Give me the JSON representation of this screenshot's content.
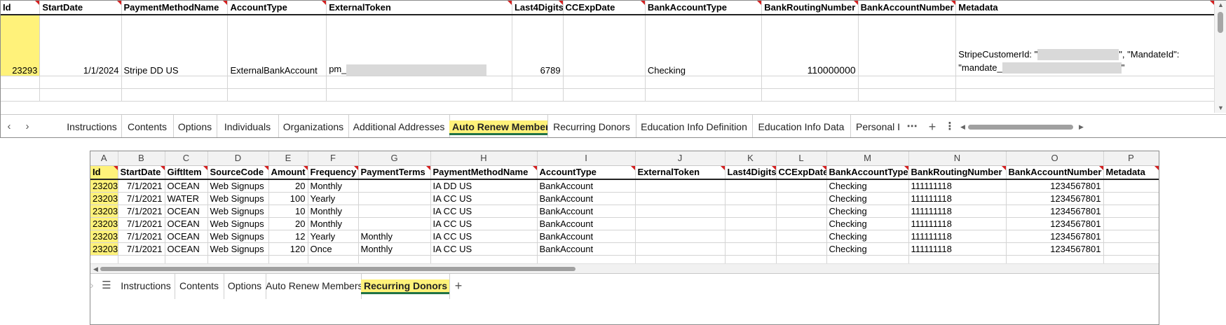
{
  "top_sheet": {
    "headers": [
      "Id",
      "StartDate",
      "PaymentMethodName",
      "AccountType",
      "ExternalToken",
      "Last4Digits",
      "CCExpDate",
      "BankAccountType",
      "BankRoutingNumber",
      "BankAccountNumber",
      "Metadata"
    ],
    "row": {
      "id": "23293",
      "start_date": "1/1/2024",
      "payment_method_name": "Stripe DD US",
      "account_type": "ExternalBankAccount",
      "external_token_prefix": "pm_",
      "last4": "6789",
      "cc_exp_date": "",
      "bank_account_type": "Checking",
      "routing": "110000000",
      "account_number": "",
      "metadata_line1_a": "StripeCustomerId: \"",
      "metadata_line1_b": "\", \"MandateId\":",
      "metadata_line2_a": "\"mandate_",
      "metadata_line2_b": "\""
    },
    "tabs": [
      "Instructions",
      "Contents",
      "Options",
      "Individuals",
      "Organizations",
      "Additional Addresses",
      "Auto Renew Members",
      "Recurring Donors",
      "Education Info Definition",
      "Education Info Data",
      "Personal I"
    ],
    "active_tab": "Auto Renew Members"
  },
  "bottom_sheet": {
    "column_letters": [
      "A",
      "B",
      "C",
      "D",
      "E",
      "F",
      "G",
      "H",
      "I",
      "J",
      "K",
      "L",
      "M",
      "N",
      "O",
      "P"
    ],
    "headers": [
      "Id",
      "StartDate",
      "GiftItem",
      "SourceCode",
      "Amount",
      "Frequency",
      "PaymentTerms",
      "PaymentMethodName",
      "AccountType",
      "ExternalToken",
      "Last4Digits",
      "CCExpDate",
      "BankAccountType",
      "BankRoutingNumber",
      "BankAccountNumber",
      "Metadata"
    ],
    "rows": [
      [
        "23203",
        "7/1/2021",
        "OCEAN",
        "Web Signups",
        "20",
        "Monthly",
        "",
        "IA DD US",
        "BankAccount",
        "",
        "",
        "",
        "Checking",
        "111111118",
        "1234567801",
        ""
      ],
      [
        "23203",
        "7/1/2021",
        "WATER",
        "Web Signups",
        "100",
        "Yearly",
        "",
        "IA CC US",
        "BankAccount",
        "",
        "",
        "",
        "Checking",
        "111111118",
        "1234567801",
        ""
      ],
      [
        "23203",
        "7/1/2021",
        "OCEAN",
        "Web Signups",
        "10",
        "Monthly",
        "",
        "IA CC US",
        "BankAccount",
        "",
        "",
        "",
        "Checking",
        "111111118",
        "1234567801",
        ""
      ],
      [
        "23203",
        "7/1/2021",
        "OCEAN",
        "Web Signups",
        "20",
        "Monthly",
        "",
        "IA CC US",
        "BankAccount",
        "",
        "",
        "",
        "Checking",
        "111111118",
        "1234567801",
        ""
      ],
      [
        "23203",
        "7/1/2021",
        "OCEAN",
        "Web Signups",
        "12",
        "Yearly",
        "Monthly",
        "IA CC US",
        "BankAccount",
        "",
        "",
        "",
        "Checking",
        "111111118",
        "1234567801",
        ""
      ],
      [
        "23203",
        "7/1/2021",
        "OCEAN",
        "Web Signups",
        "120",
        "Once",
        "Monthly",
        "IA CC US",
        "BankAccount",
        "",
        "",
        "",
        "Checking",
        "111111118",
        "1234567801",
        ""
      ]
    ],
    "tabs": [
      "Instructions",
      "Contents",
      "Options",
      "Auto Renew Members",
      "Recurring Donors"
    ],
    "active_tab": "Recurring Donors"
  },
  "icons": {
    "prev_sheet": "chevron-left-icon",
    "next_sheet": "chevron-right-icon",
    "more_sheets": "ellipsis-icon",
    "add_sheet": "plus-icon",
    "options": "vertical-ellipsis-icon",
    "sheet_list": "hamburger-menu-icon",
    "scroll_left": "triangle-left-icon",
    "scroll_right": "triangle-right-icon",
    "scroll_up": "triangle-up-icon",
    "scroll_down": "triangle-down-icon"
  },
  "colors": {
    "highlight": "#fff27a",
    "comment_marker": "#d42020",
    "active_tab_underline": "#217346"
  }
}
